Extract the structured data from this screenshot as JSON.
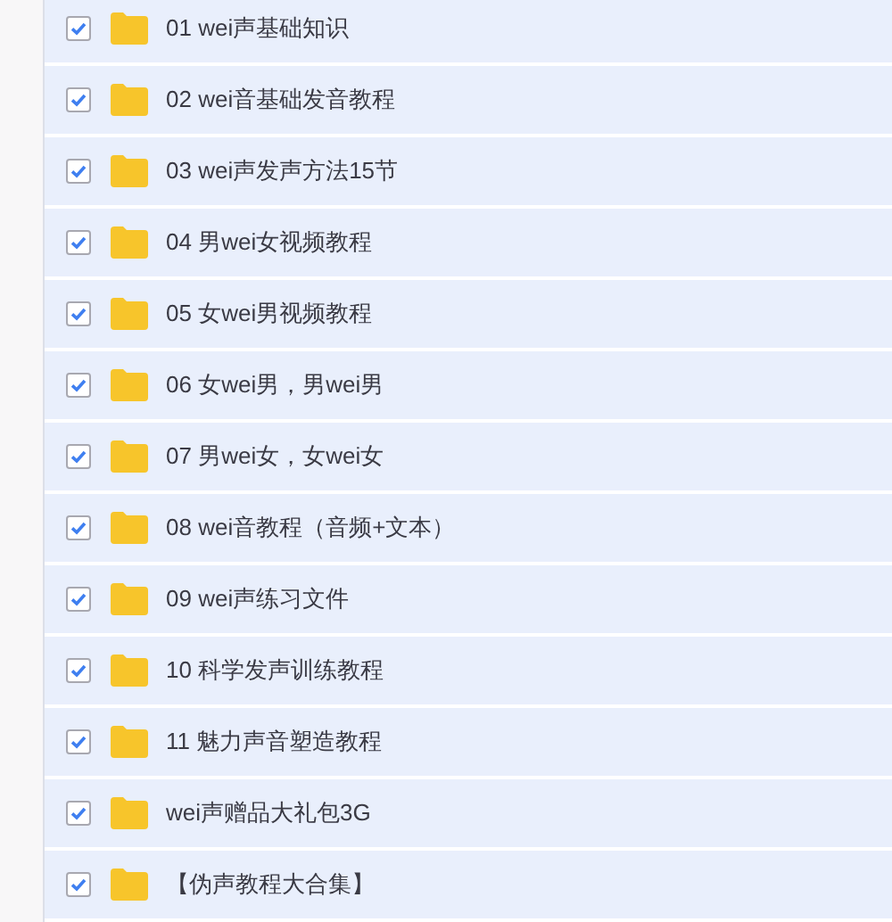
{
  "files": [
    {
      "name": "01 wei声基础知识",
      "checked": true
    },
    {
      "name": "02 wei音基础发音教程",
      "checked": true
    },
    {
      "name": "03 wei声发声方法15节",
      "checked": true
    },
    {
      "name": "04 男wei女视频教程",
      "checked": true
    },
    {
      "name": "05 女wei男视频教程",
      "checked": true
    },
    {
      "name": "06 女wei男，男wei男",
      "checked": true
    },
    {
      "name": "07 男wei女，女wei女",
      "checked": true
    },
    {
      "name": "08 wei音教程（音频+文本）",
      "checked": true
    },
    {
      "name": "09 wei声练习文件",
      "checked": true
    },
    {
      "name": "10 科学发声训练教程",
      "checked": true
    },
    {
      "name": "11 魅力声音塑造教程",
      "checked": true
    },
    {
      "name": "wei声赠品大礼包3G",
      "checked": true
    },
    {
      "name": "【伪声教程大合集】",
      "checked": true
    }
  ]
}
